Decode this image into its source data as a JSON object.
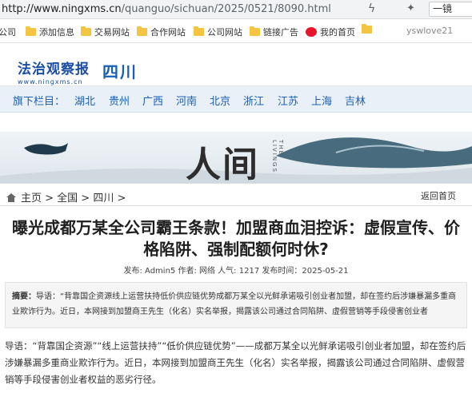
{
  "browser": {
    "url_host": "http://www.ningxms.cn",
    "url_path": "/quanguo/sichuan/2025/0521/8090.html",
    "search_text": "一镜"
  },
  "bookmarks": {
    "items": [
      {
        "label": "公司",
        "icon": "folder-icon"
      },
      {
        "label": "添加信息",
        "icon": "folder-icon"
      },
      {
        "label": "交易网站",
        "icon": "folder-icon"
      },
      {
        "label": "合作网站",
        "icon": "folder-icon"
      },
      {
        "label": "公司网站",
        "icon": "folder-icon"
      },
      {
        "label": "链接广告",
        "icon": "folder-icon"
      },
      {
        "label": "我的首页",
        "icon": "weibo-icon"
      },
      {
        "label": "",
        "icon": "folder-icon"
      }
    ],
    "right_label": "yswlove21"
  },
  "site": {
    "logo_cn": "法治观察报",
    "logo_en": "www.ningxms.cn",
    "region": "四川"
  },
  "nav": {
    "label": "旗下栏目：",
    "items": [
      "湖北",
      "贵州",
      "广西",
      "河南",
      "北京",
      "浙江",
      "江苏",
      "上海",
      "吉林"
    ]
  },
  "banner": {
    "title": "人间",
    "subtitle": "THE LIVINGS"
  },
  "breadcrumb": {
    "path": "主页 > 全国 > 四川 >",
    "back": "返回首页"
  },
  "article": {
    "title": "曝光成都万某全公司霸王条款！加盟商血泪控诉：虚假宣传、价格陷阱、强制配额何时休?",
    "meta": "发布: Admin5 作者: 网络 人气: 1217 发布时间：2025-05-21",
    "summary_label": "摘要：",
    "summary_text": "导语：“背靠国企资源线上运营扶持低价供应链优势成都万某全以光鲜承诺吸引创业者加盟，却在签约后涉嫌暴漏多重商业欺诈行为。近日，本网接到加盟商王先生（化名）实名举报，揭露该公司通过合同陷阱、虚假营销等手段侵害创业者",
    "lead": "导语：“背靠国企资源”“线上运营扶持”“低价供应链优势”——成都万某全以光鲜承诺吸引创业者加盟，却在签约后涉嫌暴漏多重商业欺诈行为。近日，本网接到加盟商王先生（化名）实名举报，揭露该公司通过合同陷阱、虚假营销等手段侵害创业者权益的恶劣行径。"
  }
}
